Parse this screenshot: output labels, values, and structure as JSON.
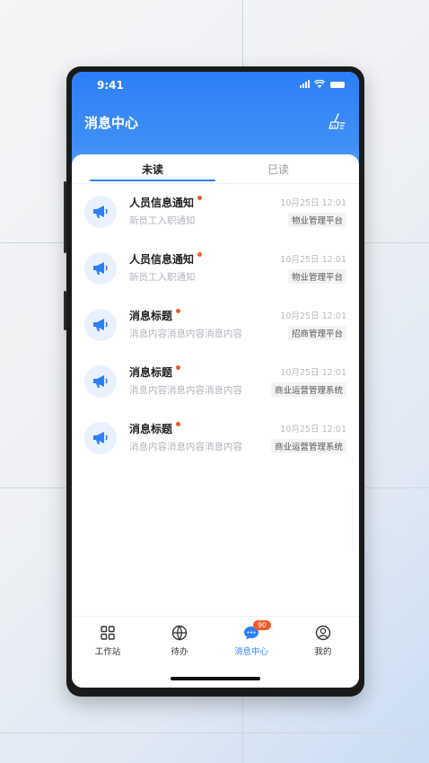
{
  "status_bar": {
    "time": "9:41"
  },
  "header": {
    "title": "消息中心",
    "clear_icon": "broom-clear-icon"
  },
  "tabs": [
    {
      "label": "未读",
      "active": true
    },
    {
      "label": "已读",
      "active": false
    }
  ],
  "messages": [
    {
      "title": "人员信息通知",
      "content": "新员工入职通知",
      "time": "10月25日 12:01",
      "tag": "物业管理平台",
      "unread": true
    },
    {
      "title": "人员信息通知",
      "content": "新员工入职通知",
      "time": "10月25日 12:01",
      "tag": "物业管理平台",
      "unread": true
    },
    {
      "title": "消息标题",
      "content": "消息内容消息内容消息内容",
      "time": "10月25日 12:01",
      "tag": "招商管理平台",
      "unread": true
    },
    {
      "title": "消息标题",
      "content": "消息内容消息内容消息内容",
      "time": "10月25日 12:01",
      "tag": "商业运营管理系统",
      "unread": true
    },
    {
      "title": "消息标题",
      "content": "消息内容消息内容消息内容",
      "time": "10月25日 12:01",
      "tag": "商业运营管理系统",
      "unread": true
    }
  ],
  "tabbar": [
    {
      "label": "工作站",
      "icon": "grid-icon",
      "active": false
    },
    {
      "label": "待办",
      "icon": "globe-icon",
      "active": false
    },
    {
      "label": "消息中心",
      "icon": "chat-icon",
      "active": true,
      "badge": "90"
    },
    {
      "label": "我的",
      "icon": "user-icon",
      "active": false
    }
  ],
  "colors": {
    "accent": "#2d7ef7",
    "badge": "#f05a28",
    "avatar_bg": "#e9f1fe"
  }
}
